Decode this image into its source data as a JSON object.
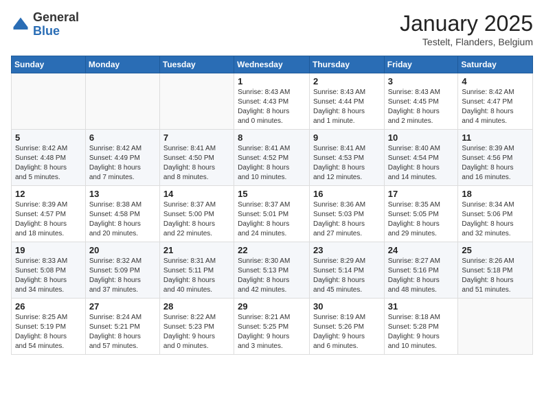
{
  "logo": {
    "general": "General",
    "blue": "Blue"
  },
  "header": {
    "month": "January 2025",
    "location": "Testelt, Flanders, Belgium"
  },
  "days_of_week": [
    "Sunday",
    "Monday",
    "Tuesday",
    "Wednesday",
    "Thursday",
    "Friday",
    "Saturday"
  ],
  "weeks": [
    [
      {
        "day": "",
        "info": ""
      },
      {
        "day": "",
        "info": ""
      },
      {
        "day": "",
        "info": ""
      },
      {
        "day": "1",
        "info": "Sunrise: 8:43 AM\nSunset: 4:43 PM\nDaylight: 8 hours\nand 0 minutes."
      },
      {
        "day": "2",
        "info": "Sunrise: 8:43 AM\nSunset: 4:44 PM\nDaylight: 8 hours\nand 1 minute."
      },
      {
        "day": "3",
        "info": "Sunrise: 8:43 AM\nSunset: 4:45 PM\nDaylight: 8 hours\nand 2 minutes."
      },
      {
        "day": "4",
        "info": "Sunrise: 8:42 AM\nSunset: 4:47 PM\nDaylight: 8 hours\nand 4 minutes."
      }
    ],
    [
      {
        "day": "5",
        "info": "Sunrise: 8:42 AM\nSunset: 4:48 PM\nDaylight: 8 hours\nand 5 minutes."
      },
      {
        "day": "6",
        "info": "Sunrise: 8:42 AM\nSunset: 4:49 PM\nDaylight: 8 hours\nand 7 minutes."
      },
      {
        "day": "7",
        "info": "Sunrise: 8:41 AM\nSunset: 4:50 PM\nDaylight: 8 hours\nand 8 minutes."
      },
      {
        "day": "8",
        "info": "Sunrise: 8:41 AM\nSunset: 4:52 PM\nDaylight: 8 hours\nand 10 minutes."
      },
      {
        "day": "9",
        "info": "Sunrise: 8:41 AM\nSunset: 4:53 PM\nDaylight: 8 hours\nand 12 minutes."
      },
      {
        "day": "10",
        "info": "Sunrise: 8:40 AM\nSunset: 4:54 PM\nDaylight: 8 hours\nand 14 minutes."
      },
      {
        "day": "11",
        "info": "Sunrise: 8:39 AM\nSunset: 4:56 PM\nDaylight: 8 hours\nand 16 minutes."
      }
    ],
    [
      {
        "day": "12",
        "info": "Sunrise: 8:39 AM\nSunset: 4:57 PM\nDaylight: 8 hours\nand 18 minutes."
      },
      {
        "day": "13",
        "info": "Sunrise: 8:38 AM\nSunset: 4:58 PM\nDaylight: 8 hours\nand 20 minutes."
      },
      {
        "day": "14",
        "info": "Sunrise: 8:37 AM\nSunset: 5:00 PM\nDaylight: 8 hours\nand 22 minutes."
      },
      {
        "day": "15",
        "info": "Sunrise: 8:37 AM\nSunset: 5:01 PM\nDaylight: 8 hours\nand 24 minutes."
      },
      {
        "day": "16",
        "info": "Sunrise: 8:36 AM\nSunset: 5:03 PM\nDaylight: 8 hours\nand 27 minutes."
      },
      {
        "day": "17",
        "info": "Sunrise: 8:35 AM\nSunset: 5:05 PM\nDaylight: 8 hours\nand 29 minutes."
      },
      {
        "day": "18",
        "info": "Sunrise: 8:34 AM\nSunset: 5:06 PM\nDaylight: 8 hours\nand 32 minutes."
      }
    ],
    [
      {
        "day": "19",
        "info": "Sunrise: 8:33 AM\nSunset: 5:08 PM\nDaylight: 8 hours\nand 34 minutes."
      },
      {
        "day": "20",
        "info": "Sunrise: 8:32 AM\nSunset: 5:09 PM\nDaylight: 8 hours\nand 37 minutes."
      },
      {
        "day": "21",
        "info": "Sunrise: 8:31 AM\nSunset: 5:11 PM\nDaylight: 8 hours\nand 40 minutes."
      },
      {
        "day": "22",
        "info": "Sunrise: 8:30 AM\nSunset: 5:13 PM\nDaylight: 8 hours\nand 42 minutes."
      },
      {
        "day": "23",
        "info": "Sunrise: 8:29 AM\nSunset: 5:14 PM\nDaylight: 8 hours\nand 45 minutes."
      },
      {
        "day": "24",
        "info": "Sunrise: 8:27 AM\nSunset: 5:16 PM\nDaylight: 8 hours\nand 48 minutes."
      },
      {
        "day": "25",
        "info": "Sunrise: 8:26 AM\nSunset: 5:18 PM\nDaylight: 8 hours\nand 51 minutes."
      }
    ],
    [
      {
        "day": "26",
        "info": "Sunrise: 8:25 AM\nSunset: 5:19 PM\nDaylight: 8 hours\nand 54 minutes."
      },
      {
        "day": "27",
        "info": "Sunrise: 8:24 AM\nSunset: 5:21 PM\nDaylight: 8 hours\nand 57 minutes."
      },
      {
        "day": "28",
        "info": "Sunrise: 8:22 AM\nSunset: 5:23 PM\nDaylight: 9 hours\nand 0 minutes."
      },
      {
        "day": "29",
        "info": "Sunrise: 8:21 AM\nSunset: 5:25 PM\nDaylight: 9 hours\nand 3 minutes."
      },
      {
        "day": "30",
        "info": "Sunrise: 8:19 AM\nSunset: 5:26 PM\nDaylight: 9 hours\nand 6 minutes."
      },
      {
        "day": "31",
        "info": "Sunrise: 8:18 AM\nSunset: 5:28 PM\nDaylight: 9 hours\nand 10 minutes."
      },
      {
        "day": "",
        "info": ""
      }
    ]
  ]
}
